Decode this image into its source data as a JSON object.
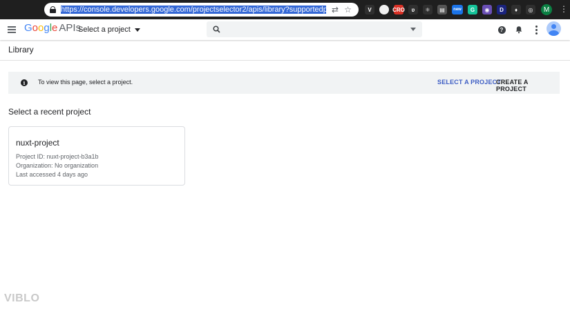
{
  "browser": {
    "url_prefix": "https://",
    "url_rest": "console.developers.google.com/projectselector2/apis/library?supportedpurview=project",
    "profile_initial": "M",
    "extensions": [
      {
        "name": "vue-devtools-icon",
        "label": "V",
        "color": "#2f2f2f"
      },
      {
        "name": "circle-extension-icon",
        "label": "",
        "color": "#f1f1f1"
      },
      {
        "name": "red-extension-icon",
        "label": "CRO",
        "color": "#d93025"
      },
      {
        "name": "script-extension-icon",
        "label": "ʋ",
        "color": "#2f2f2f"
      },
      {
        "name": "react-devtools-icon",
        "label": "⚛",
        "color": "#2f2f2f"
      },
      {
        "name": "note-extension-icon",
        "label": "▤",
        "color": "#555555"
      },
      {
        "name": "new-badge-extension-icon",
        "label": "new",
        "color": "#1a73e8"
      },
      {
        "name": "grammarly-icon",
        "label": "G",
        "color": "#15c39a"
      },
      {
        "name": "colorful-extension-icon",
        "label": "◉",
        "color": "#6a4fb5"
      },
      {
        "name": "duplicate-extension-icon",
        "label": "D",
        "color": "#1a237e"
      },
      {
        "name": "diamond-extension-icon",
        "label": "♦",
        "color": "#2f2f2f"
      },
      {
        "name": "target-extension-icon",
        "label": "◎",
        "color": "#2f2f2f"
      }
    ]
  },
  "header": {
    "logo_letters": [
      "G",
      "o",
      "o",
      "g",
      "l",
      "e"
    ],
    "logo_product": "APIs",
    "project_select_label": "Select a project",
    "search_placeholder": ""
  },
  "page": {
    "title": "Library",
    "banner_text": "To view this page, select a project.",
    "select_button": "SELECT A PROJECT",
    "create_button": "CREATE A PROJECT",
    "recent_title": "Select a recent project"
  },
  "recent_projects": [
    {
      "name": "nuxt-project",
      "project_id": "Project ID: nuxt-project-b3a1b",
      "organization": "Organization: No organization",
      "last_accessed": "Last accessed 4 days ago"
    }
  ],
  "watermark": "VIBLO",
  "colors": {
    "accent_blue": "#3c5cc4",
    "banner_bg": "#f1f3f4",
    "chrome_bg": "#1f1f1f"
  }
}
